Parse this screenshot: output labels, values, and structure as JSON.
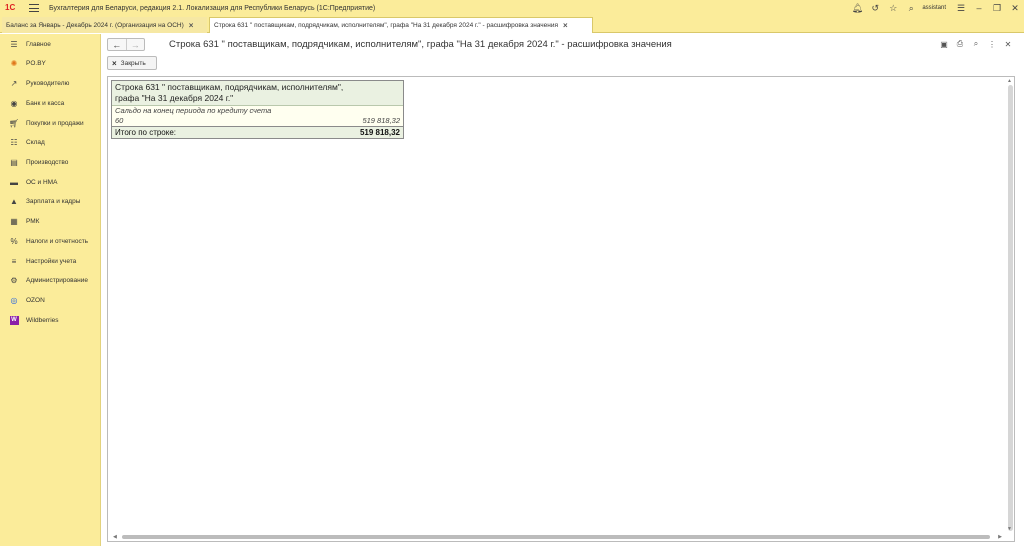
{
  "app": {
    "logo": "1С",
    "title": "Бухгалтерия для Беларуси, редакция 2.1. Локализация для Республики Беларусь   (1С:Предприятие)",
    "user": "assistant",
    "icons": [
      "bell-icon",
      "history-icon",
      "star-icon",
      "search-icon",
      "settings-icon",
      "minimize-icon",
      "restore-icon",
      "close-icon"
    ]
  },
  "tabs": [
    {
      "label": "Баланс за Январь - Декабрь 2024 г. (Организация на ОСН)",
      "close": "×"
    },
    {
      "label": "Строка 631 \" поставщикам, подрядчикам, исполнителям\", графа \"На 31 декабря 2024 г.\" - расшифровка значения",
      "close": "×"
    }
  ],
  "sidebar": {
    "items": [
      {
        "label": "Главное",
        "icon": "menu-icon"
      },
      {
        "label": "PO.BY",
        "icon": "sun-icon"
      },
      {
        "label": "Руководителю",
        "icon": "trend-icon"
      },
      {
        "label": "Банк и касса",
        "icon": "coin-icon"
      },
      {
        "label": "Покупки и продажи",
        "icon": "cart-icon"
      },
      {
        "label": "Склад",
        "icon": "warehouse-icon"
      },
      {
        "label": "Производство",
        "icon": "factory-icon"
      },
      {
        "label": "ОС и НМА",
        "icon": "truck-icon"
      },
      {
        "label": "Зарплата и кадры",
        "icon": "person-icon"
      },
      {
        "label": "РМК",
        "icon": "register-icon"
      },
      {
        "label": "Налоги и отчетность",
        "icon": "tax-icon"
      },
      {
        "label": "Настройки учета",
        "icon": "list-icon"
      },
      {
        "label": "Администрирование",
        "icon": "gear-icon"
      },
      {
        "label": "OZON",
        "icon": "ozon-icon"
      },
      {
        "label": "Wildberries",
        "icon": "wildberries-icon"
      }
    ]
  },
  "form": {
    "back": "←",
    "forward": "→",
    "title": "Строка 631 \" поставщикам, подрядчикам, исполнителям\", графа \"На 31 декабря 2024 г.\" - расшифровка значения",
    "close_label": "Закрыть",
    "close_mark": "×"
  },
  "report": {
    "heading_line1": "Строка 631 \" поставщикам, подрядчикам, исполнителям\",",
    "heading_line2": "графа \"На 31 декабря 2024 г.\"",
    "sub_label": "Сальдо на конец периода по кредиту счета",
    "account": "60",
    "account_value": "519 818,32",
    "total_label": "Итого по строке:",
    "total_value": "519 818,32"
  }
}
